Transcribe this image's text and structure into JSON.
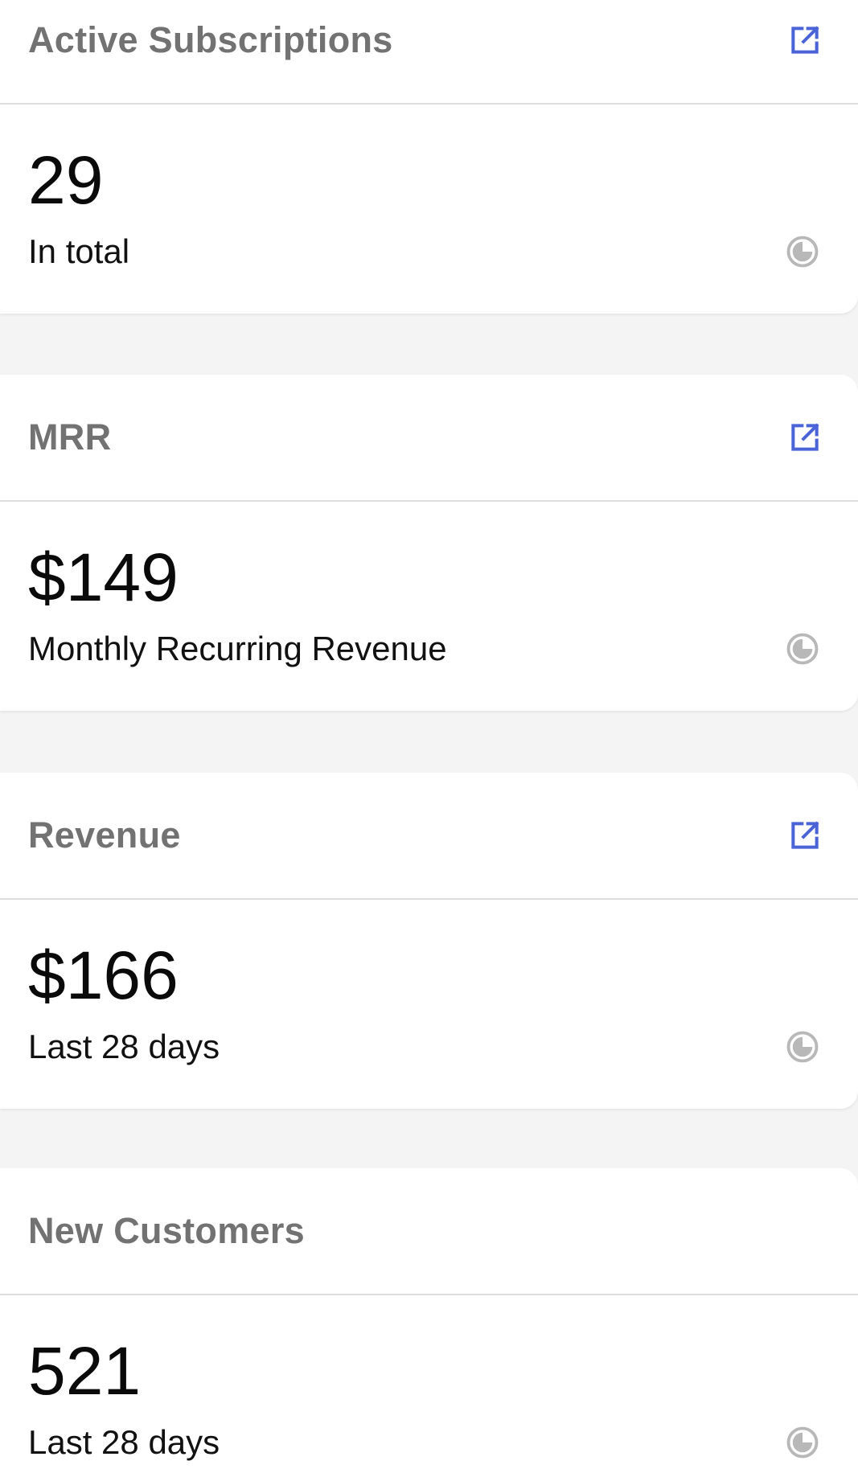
{
  "colors": {
    "background": "#f4f4f4",
    "card": "#ffffff",
    "title": "#727272",
    "value": "#0a0a0a",
    "link_icon": "#4a63d6",
    "status_icon": "#b8b8b8"
  },
  "cards": [
    {
      "title": "Active Subscriptions",
      "value": "29",
      "caption": "In total",
      "has_link": true,
      "link_icon": "external-link-icon",
      "status_icon": "clock-icon"
    },
    {
      "title": "MRR",
      "value": "$149",
      "caption": "Monthly Recurring Revenue",
      "has_link": true,
      "link_icon": "external-link-icon",
      "status_icon": "clock-icon"
    },
    {
      "title": "Revenue",
      "value": "$166",
      "caption": "Last 28 days",
      "has_link": true,
      "link_icon": "external-link-icon",
      "status_icon": "clock-icon"
    },
    {
      "title": "New Customers",
      "value": "521",
      "caption": "Last 28 days",
      "has_link": false,
      "status_icon": "clock-icon"
    }
  ]
}
